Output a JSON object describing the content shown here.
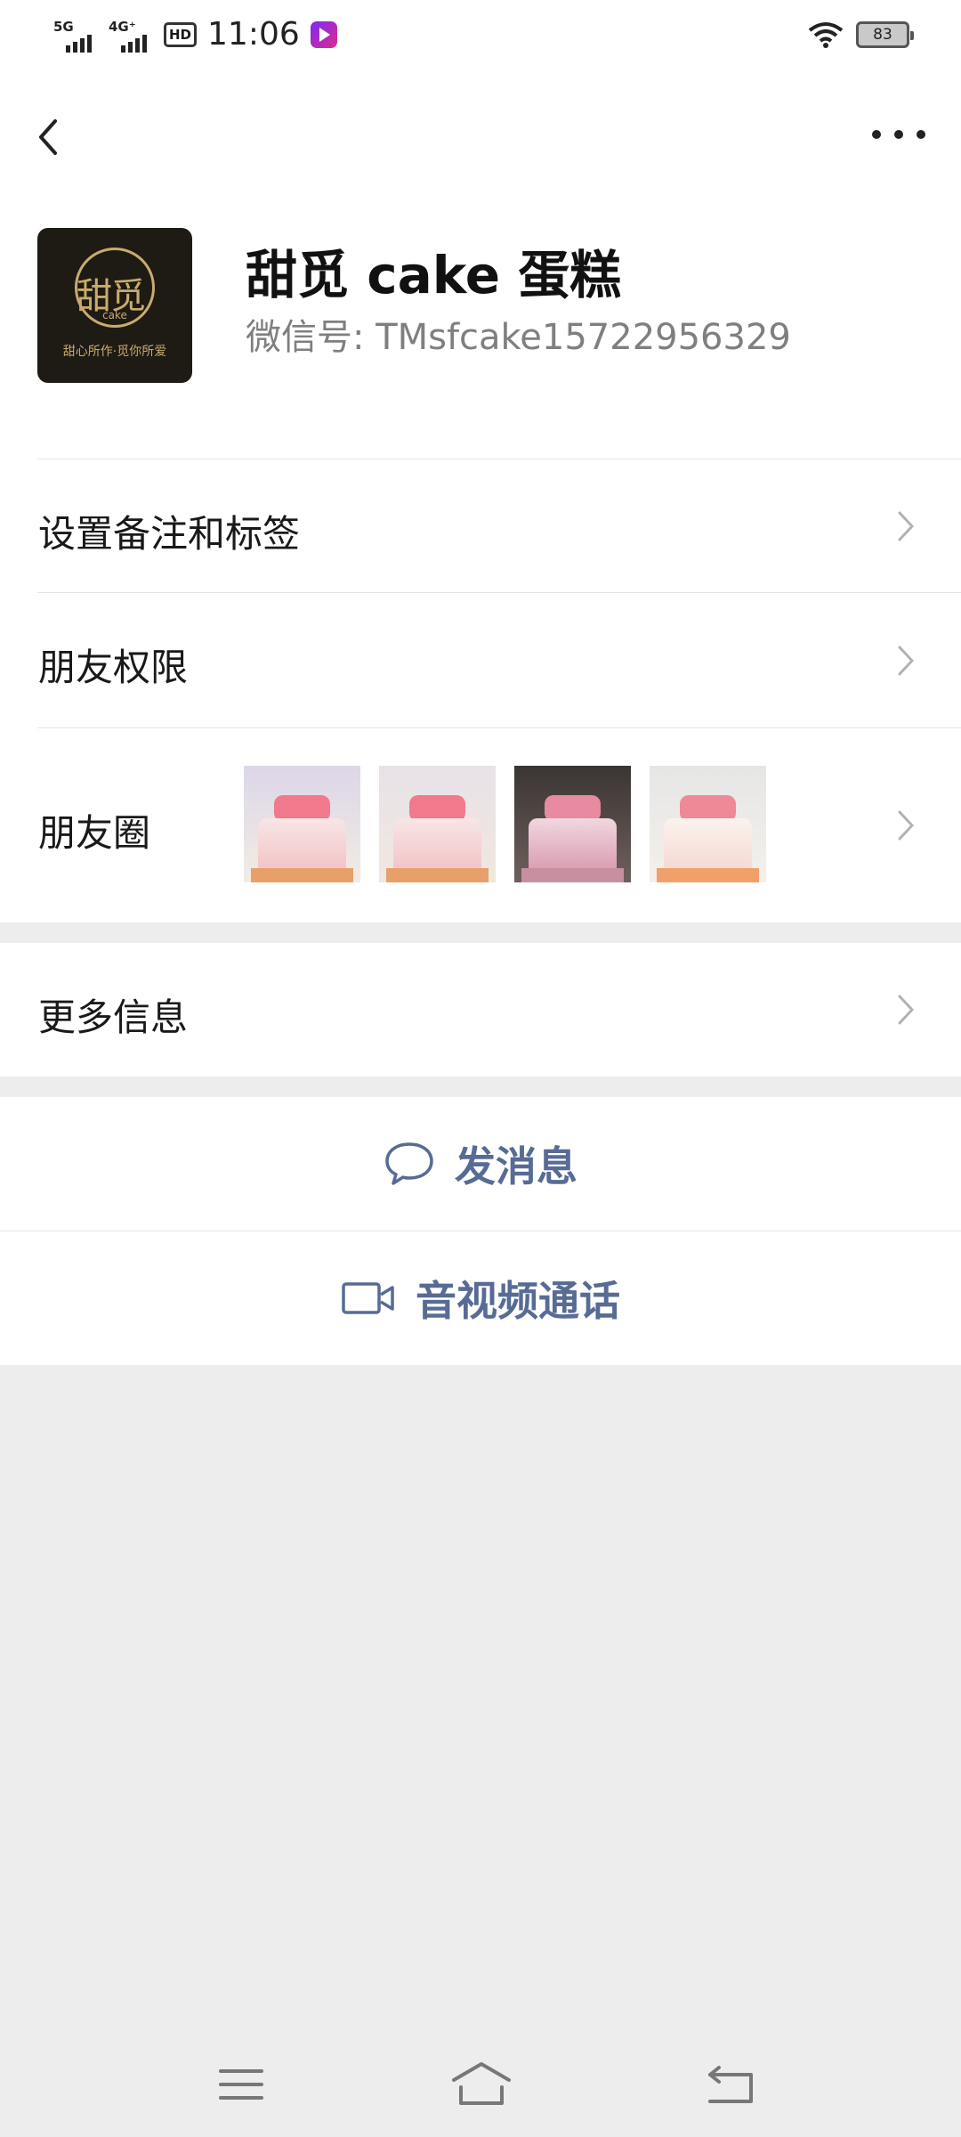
{
  "status_bar": {
    "signal1": "5G",
    "signal2": "4G⁺",
    "hd_badge": "HD",
    "time": "11:06",
    "battery": "83",
    "icons": [
      "signal-icon",
      "hd-icon",
      "video-app-icon",
      "wifi-icon",
      "battery-icon"
    ]
  },
  "nav": {
    "back_icon": "chevron-left-icon",
    "more_icon": "more-dots-icon"
  },
  "profile": {
    "avatar": {
      "main": "甜觅",
      "sub": "cake",
      "slogan": "甜心所作·觅你所爱"
    },
    "name": "甜觅 cake 蛋糕",
    "wechat_id": "微信号: TMsfcake15722956329"
  },
  "rows": {
    "remark": "设置备注和标签",
    "permissions": "朋友权限",
    "moments": "朋友圈",
    "more_info": "更多信息"
  },
  "moments_thumbnails": [
    "cake-photo-1",
    "cake-photo-2",
    "cake-photo-3",
    "cake-photo-4"
  ],
  "actions": {
    "message": "发消息",
    "video_call": "音视频通话"
  },
  "colors": {
    "link_blue": "#576b95",
    "page_bg": "#ededed",
    "card_bg": "#ffffff",
    "secondary_text": "#7f7f7f",
    "avatar_gold": "#c9ab6c"
  }
}
